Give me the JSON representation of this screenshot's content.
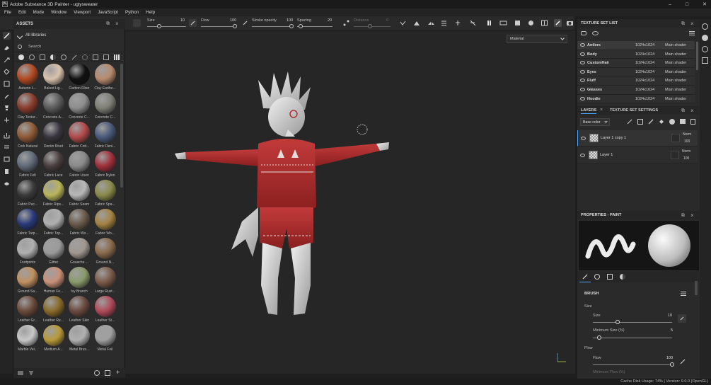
{
  "title": {
    "app_icon": "Pt",
    "text": "Adobe Substance 3D Painter - uglysweater"
  },
  "window_controls": [
    "–",
    "□",
    "✕"
  ],
  "menu": [
    "File",
    "Edit",
    "Mode",
    "Window",
    "Viewport",
    "JavaScript",
    "Python",
    "Help"
  ],
  "toolbar": {
    "size_label": "Size",
    "size_value": "10",
    "flow_label": "Flow",
    "flow_value": "100",
    "stroke_label": "Stroke opacity",
    "stroke_value": "100",
    "spacing_label": "Spacing",
    "spacing_value": "20",
    "distance_label": "Distance",
    "distance_value": "0"
  },
  "assets": {
    "title": "ASSETS",
    "library": "All libraries",
    "search_placeholder": "Search",
    "materials": [
      {
        "name": "Autumn L...",
        "color": "#b24a22"
      },
      {
        "name": "Baked Lig...",
        "color": "#d9c2ad"
      },
      {
        "name": "Carbon Fiber",
        "color": "#111111"
      },
      {
        "name": "Clay Earthe...",
        "color": "#b88a6d"
      },
      {
        "name": "Clay Textur...",
        "color": "#8a3c2b"
      },
      {
        "name": "Concrete A...",
        "color": "#5a5a5a"
      },
      {
        "name": "Concrete C...",
        "color": "#8d8d8d"
      },
      {
        "name": "Concrete C...",
        "color": "#7f7f77"
      },
      {
        "name": "Cork Natural",
        "color": "#8e5a36"
      },
      {
        "name": "Denim Rivet",
        "color": "#3a3640"
      },
      {
        "name": "Fabric Cott...",
        "color": "#b24a4a"
      },
      {
        "name": "Fabric Deni...",
        "color": "#4a5a7a"
      },
      {
        "name": "Fabric Felt",
        "color": "#606a78"
      },
      {
        "name": "Fabric Lace",
        "color": "#4a3e3e"
      },
      {
        "name": "Fabric Linen",
        "color": "#8a8a8a"
      },
      {
        "name": "Fabric Nylon",
        "color": "#a0303a"
      },
      {
        "name": "Fabric Puc...",
        "color": "#3a3a3a"
      },
      {
        "name": "Fabric Rips...",
        "color": "#b9b55a"
      },
      {
        "name": "Fabric Seam",
        "color": "#b8b8b8"
      },
      {
        "name": "Fabric Spa...",
        "color": "#8a8a4a"
      },
      {
        "name": "Fabric Tarp...",
        "color": "#2a3a7a"
      },
      {
        "name": "Fabric Top...",
        "color": "#b0b0b0"
      },
      {
        "name": "Fabric Wo...",
        "color": "#6a5a4a"
      },
      {
        "name": "Fabric Wo...",
        "color": "#a48242"
      },
      {
        "name": "Footprints",
        "color": "#b0b0b0"
      },
      {
        "name": "Glitter",
        "color": "#9a9a9a"
      },
      {
        "name": "Gouache ...",
        "color": "#a09890"
      },
      {
        "name": "Ground N...",
        "color": "#8a6a4a"
      },
      {
        "name": "Ground Sa...",
        "color": "#c09060"
      },
      {
        "name": "Human Fe...",
        "color": "#c89078"
      },
      {
        "name": "Ivy Branch",
        "color": "#8a9a6a"
      },
      {
        "name": "Large Rust...",
        "color": "#7a5a48"
      },
      {
        "name": "Leather Gr...",
        "color": "#6a4a3a"
      },
      {
        "name": "Leather Re...",
        "color": "#8a6a2a"
      },
      {
        "name": "Leather Skin",
        "color": "#6a4a3e"
      },
      {
        "name": "Leather St...",
        "color": "#b04a5a"
      },
      {
        "name": "Marble Vei...",
        "color": "#c8c8c8"
      },
      {
        "name": "Medium A...",
        "color": "#b89a3a"
      },
      {
        "name": "Metal Brus...",
        "color": "#b0b0b0"
      },
      {
        "name": "Metal Foil",
        "color": "#a0a0a0"
      }
    ]
  },
  "viewport": {
    "mode_select": "Material"
  },
  "texture_set_list": {
    "title": "TEXTURE SET LIST",
    "rows": [
      {
        "name": "Antlers",
        "res": "1024x1024",
        "shader": "Main shader"
      },
      {
        "name": "Body",
        "res": "1024x1024",
        "shader": "Main shader"
      },
      {
        "name": "CustomHair",
        "res": "1024x1024",
        "shader": "Main shader"
      },
      {
        "name": "Eyes",
        "res": "1024x1024",
        "shader": "Main shader"
      },
      {
        "name": "Fluff",
        "res": "1024x1024",
        "shader": "Main shader"
      },
      {
        "name": "Glasses",
        "res": "1024x1024",
        "shader": "Main shader"
      },
      {
        "name": "Hoodie",
        "res": "1024x1024",
        "shader": "Main shader"
      }
    ]
  },
  "layers": {
    "tab_layers": "LAYERS",
    "tab_settings": "TEXTURE SET SETTINGS",
    "channel": "Base color",
    "rows": [
      {
        "name": "Layer 1 copy 1",
        "blend": "Norm",
        "opacity": "100"
      },
      {
        "name": "Layer 1",
        "blend": "Norm",
        "opacity": "100"
      }
    ]
  },
  "properties": {
    "title": "PROPERTIES - PAINT",
    "brush_title": "BRUSH",
    "size_group": "Size",
    "size_label": "Size",
    "size_value": "10",
    "min_size_label": "Minimum Size (%)",
    "min_size_value": "5",
    "flow_group": "Flow",
    "flow_label": "Flow",
    "flow_value": "100",
    "min_flow_label": "Minimum Flow (%)"
  },
  "status": {
    "text": "Cache Disk Usage:  74% | Version: 9.0.0 (OpenGL)"
  }
}
